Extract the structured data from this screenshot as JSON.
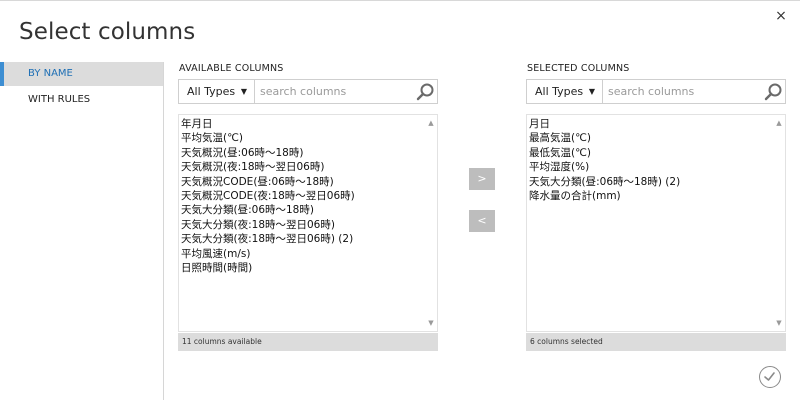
{
  "dialog": {
    "title": "Select columns",
    "close_icon": "close-icon",
    "close_glyph": "×",
    "ok_icon": "checkmark-icon"
  },
  "sidebar": {
    "items": [
      {
        "label": "BY NAME",
        "active": true
      },
      {
        "label": "WITH RULES",
        "active": false
      }
    ]
  },
  "available": {
    "header": "AVAILABLE COLUMNS",
    "type_select": "All Types",
    "search_placeholder": "search columns",
    "items": [
      "年月日",
      "平均気温(℃)",
      "天気概況(昼:06時〜18時)",
      "天気概況(夜:18時〜翌日06時)",
      "天気概況CODE(昼:06時〜18時)",
      "天気概況CODE(夜:18時〜翌日06時)",
      "天気大分類(昼:06時〜18時)",
      "天気大分類(夜:18時〜翌日06時)",
      "天気大分類(夜:18時〜翌日06時) (2)",
      "平均風速(m/s)",
      "日照時間(時間)"
    ],
    "footer": "11 columns available"
  },
  "selected": {
    "header": "SELECTED COLUMNS",
    "type_select": "All Types",
    "search_placeholder": "search columns",
    "items": [
      "月日",
      "最高気温(℃)",
      "最低気温(℃)",
      "平均湿度(%)",
      "天気大分類(昼:06時〜18時) (2)",
      "降水量の合計(mm)"
    ],
    "footer": "6 columns selected"
  },
  "controls": {
    "add_label": ">",
    "remove_label": "<",
    "caret_glyph": "▼",
    "scroll_up_glyph": "▲",
    "scroll_down_glyph": "▼"
  },
  "colors": {
    "accent": "#3d8ed2",
    "active_bg": "#dcdcdc",
    "button_gray": "#bdbdbd"
  }
}
